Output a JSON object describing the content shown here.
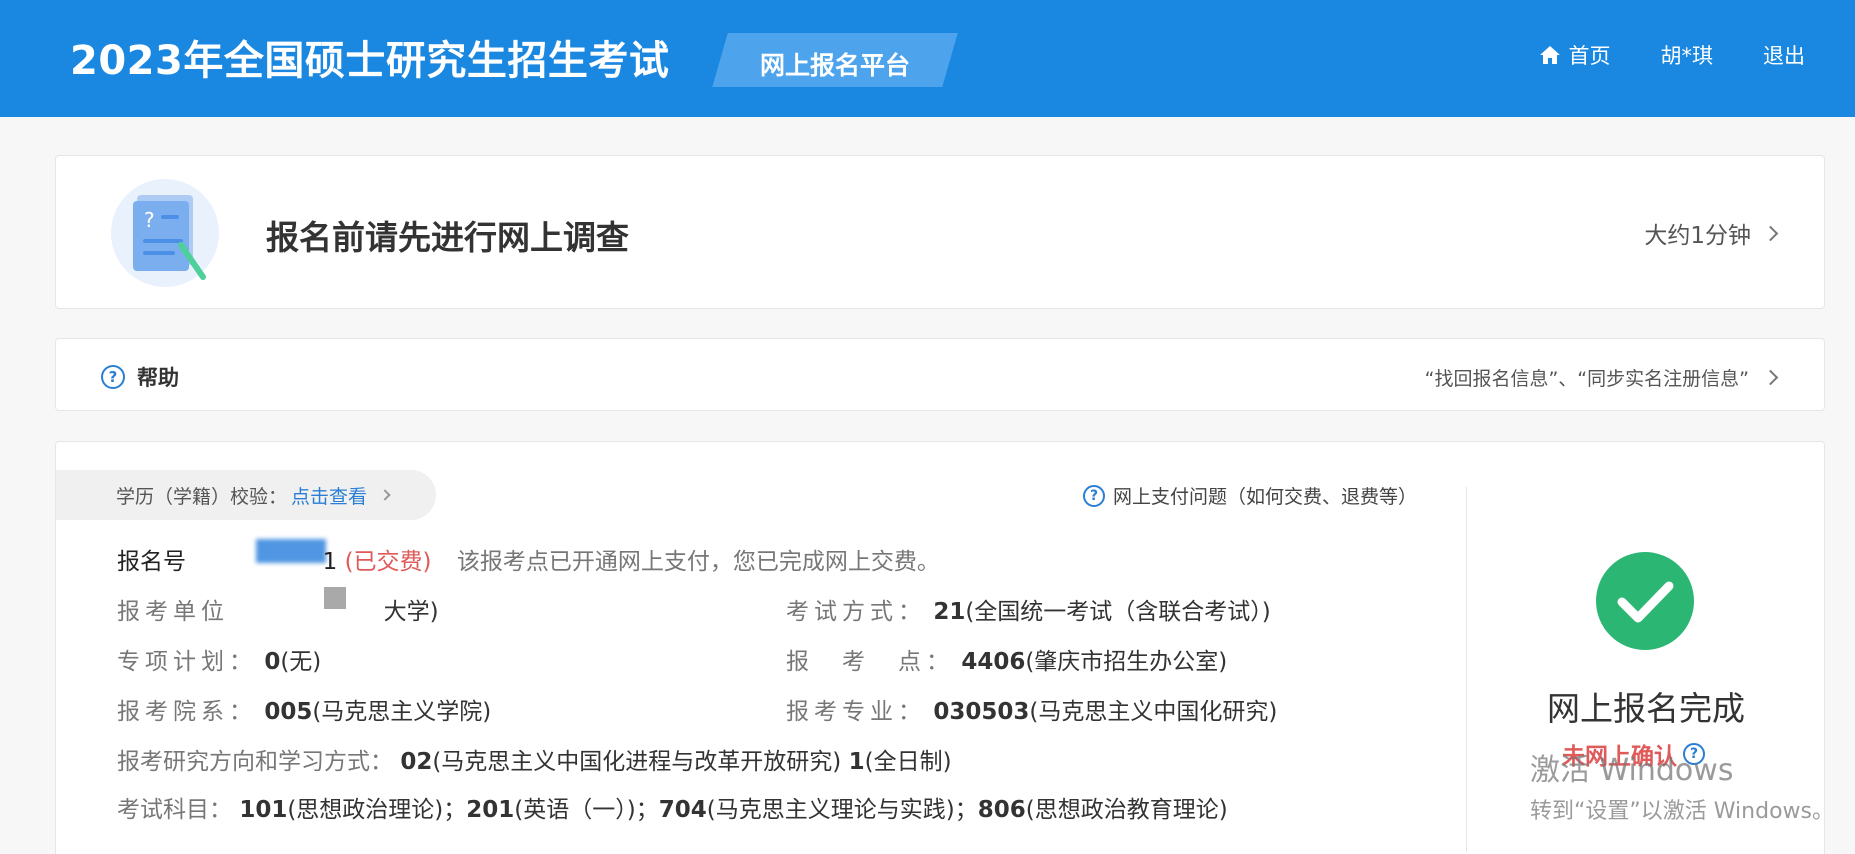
{
  "header": {
    "title": "2023年全国硕士研究生招生考试",
    "platform_tag": "网上报名平台",
    "nav": {
      "home": "首页",
      "user": "胡*琪",
      "logout": "退出"
    }
  },
  "survey": {
    "title": "报名前请先进行网上调查",
    "duration": "大约1分钟"
  },
  "help": {
    "label": "帮助",
    "links": "“找回报名信息”、“同步实名注册信息”"
  },
  "verify": {
    "label": "学历（学籍）校验：",
    "link": "点击查看"
  },
  "payment_help": "网上支付问题（如何交费、退费等）",
  "registration": {
    "number_label": "报名号",
    "number_tail": "1",
    "paid_status": "(已交费)",
    "payment_note": "该报考点已开通网上支付，您已完成网上交费。",
    "unit_label": "报考单位",
    "unit_value": "大学)",
    "exam_mode_label": "考试方式：",
    "exam_mode_code": "21",
    "exam_mode_name": "(全国统一考试（含联合考试）)",
    "special_plan_label": "专项计划：",
    "special_plan_code": "0",
    "special_plan_name": "(无)",
    "exam_site_label": "报　考　点：",
    "exam_site_code": "4406",
    "exam_site_name": "(肇庆市招生办公室)",
    "department_label": "报考院系：",
    "department_code": "005",
    "department_name": "(马克思主义学院)",
    "major_label": "报考专业：",
    "major_code": "030503",
    "major_name": "(马克思主义中国化研究)",
    "direction_label": "报考研究方向和学习方式：",
    "direction_code": "02",
    "direction_name": "(马克思主义中国化进程与改革开放研究)",
    "study_mode_code": "1",
    "study_mode_name": "(全日制)",
    "subjects_label": "考试科目：",
    "subjects": [
      {
        "code": "101",
        "name": "(思想政治理论)"
      },
      {
        "code": "201",
        "name": "(英语（一）)"
      },
      {
        "code": "704",
        "name": "(马克思主义理论与实践)"
      },
      {
        "code": "806",
        "name": "(思想政治教育理论)"
      }
    ],
    "separator": "；"
  },
  "status": {
    "done": "网上报名完成",
    "not_confirmed": "未网上确认"
  },
  "watermark": {
    "line1": "激活 Windows",
    "line2": "转到“设置”以激活 Windows。"
  },
  "colors": {
    "header_bg": "#1a87e0",
    "accent": "#2a7fd4",
    "success": "#2bb673",
    "alert": "#e05a5a"
  },
  "icons": [
    "home-icon",
    "survey-illustration",
    "question-icon",
    "chevron-right-icon",
    "check-circle-icon"
  ]
}
